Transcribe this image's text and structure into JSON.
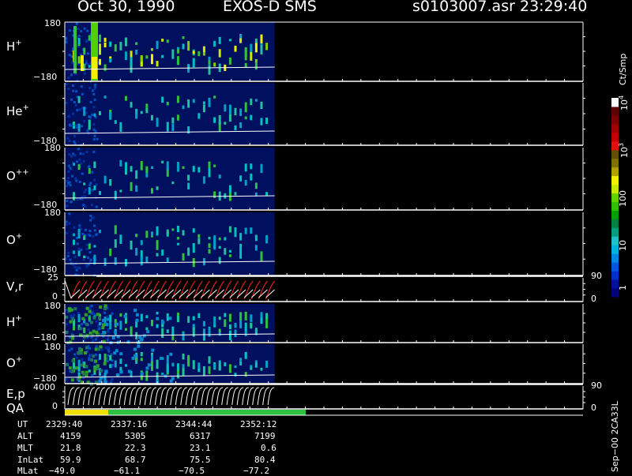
{
  "header": {
    "date": "Oct 30, 1990",
    "instrument": "EXOS-D SMS",
    "file": "s0103007.asr",
    "time": "23:29:40"
  },
  "panels": [
    {
      "ion": "H",
      "charge": "+",
      "ytop": "180",
      "ybot": "−180",
      "data_end_fraction": 0.405
    },
    {
      "ion": "He",
      "charge": "+",
      "ytop": "180",
      "ybot": "−180",
      "data_end_fraction": 0.405
    },
    {
      "ion": "O",
      "charge": "++",
      "ytop": "180",
      "ybot": "−180",
      "data_end_fraction": 0.405
    },
    {
      "ion": "O",
      "charge": "+",
      "ytop": "180",
      "ybot": "−180",
      "data_end_fraction": 0.405
    },
    {
      "ion": "V,r",
      "charge": "",
      "ytop": "25",
      "ybot": "0",
      "right_top": "90",
      "right_bot": "0"
    },
    {
      "ion": "H",
      "charge": "+",
      "ytop": "180",
      "ybot": "−180",
      "data_end_fraction": 0.405
    },
    {
      "ion": "O",
      "charge": "+",
      "ytop": "180",
      "ybot": "−180",
      "data_end_fraction": 0.405
    },
    {
      "ion": "E,p",
      "charge": "",
      "ytop": "4000",
      "ybot": "0",
      "right_top": "90",
      "right_bot": "0"
    }
  ],
  "qa_label": "QA",
  "colorbar": {
    "unit": "Ct/Smp",
    "ticks": [
      "1",
      "10",
      "100",
      "10",
      "10"
    ],
    "tick_exponents": [
      "",
      "",
      "",
      "3",
      "4"
    ],
    "colors": [
      "#00007f",
      "#0010a0",
      "#0030c8",
      "#0058e0",
      "#0088e8",
      "#00b0e0",
      "#20c0c8",
      "#00a080",
      "#008040",
      "#00a000",
      "#30c000",
      "#60d000",
      "#c8e800",
      "#f0f000",
      "#b0a000",
      "#807000",
      "#605000",
      "#e01010",
      "#c00000",
      "#a00000",
      "#800000",
      "#600000",
      "#ffffff"
    ]
  },
  "orbit": {
    "labels": [
      "UT",
      "ALT",
      "MLT",
      "InLat",
      "MLat"
    ],
    "columns": [
      [
        "2329:40",
        "4159",
        "21.8",
        "59.9",
        "−49.0"
      ],
      [
        "2337:16",
        "5305",
        "22.3",
        "68.7",
        "−61.1"
      ],
      [
        "2344:44",
        "6317",
        "23.1",
        "75.5",
        "−70.5"
      ],
      [
        "2352:12",
        "7199",
        "0.6",
        "80.4",
        "−77.2"
      ]
    ]
  },
  "footer_code": "Sep−00 2CA33L",
  "chart_data": {
    "type": "heatmap",
    "title": "Oct 30, 1990   EXOS-D SMS",
    "x_ticks_ut": [
      "2329:40",
      "2337:16",
      "2344:44",
      "2352:12"
    ],
    "pitch_angle_range": [
      -180,
      180
    ],
    "series": [
      {
        "name": "H+"
      },
      {
        "name": "He+"
      },
      {
        "name": "O++"
      },
      {
        "name": "O+"
      },
      {
        "name": "V,r",
        "ylim": [
          0,
          25
        ],
        "right_ylim": [
          0,
          90
        ]
      },
      {
        "name": "H+"
      },
      {
        "name": "O+"
      },
      {
        "name": "E,p",
        "ylim": [
          0,
          4000
        ],
        "right_ylim": [
          0,
          90
        ]
      }
    ],
    "color_scale": {
      "label": "Ct/Smp",
      "scale": "log",
      "range": [
        1,
        10000
      ]
    }
  }
}
